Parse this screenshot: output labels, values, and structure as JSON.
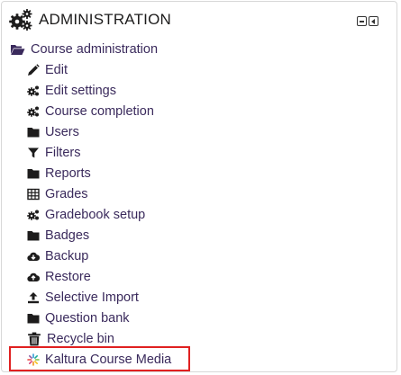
{
  "block": {
    "title": "ADMINISTRATION",
    "title_icon": "gears-icon",
    "hide_control": "collapse-block-icon",
    "dock_control": "dock-block-icon"
  },
  "tree": {
    "root_label": "Course administration",
    "root_icon": "folder-open-icon",
    "items": [
      {
        "label": "Edit",
        "icon": "pencil-icon"
      },
      {
        "label": "Edit settings",
        "icon": "gear-icon"
      },
      {
        "label": "Course completion",
        "icon": "gear-icon"
      },
      {
        "label": "Users",
        "icon": "folder-icon"
      },
      {
        "label": "Filters",
        "icon": "filter-icon"
      },
      {
        "label": "Reports",
        "icon": "folder-icon"
      },
      {
        "label": "Grades",
        "icon": "table-icon"
      },
      {
        "label": "Gradebook setup",
        "icon": "gear-icon"
      },
      {
        "label": "Badges",
        "icon": "folder-icon"
      },
      {
        "label": "Backup",
        "icon": "cloud-download-icon"
      },
      {
        "label": "Restore",
        "icon": "cloud-upload-icon"
      },
      {
        "label": "Selective Import",
        "icon": "upload-icon"
      },
      {
        "label": "Question bank",
        "icon": "folder-icon"
      },
      {
        "label": "Recycle bin",
        "icon": "trash-icon"
      },
      {
        "label": "Kaltura Course Media",
        "icon": "kaltura-icon"
      }
    ]
  },
  "colors": {
    "link": "#3a2a5c",
    "highlight": "#e02020"
  }
}
